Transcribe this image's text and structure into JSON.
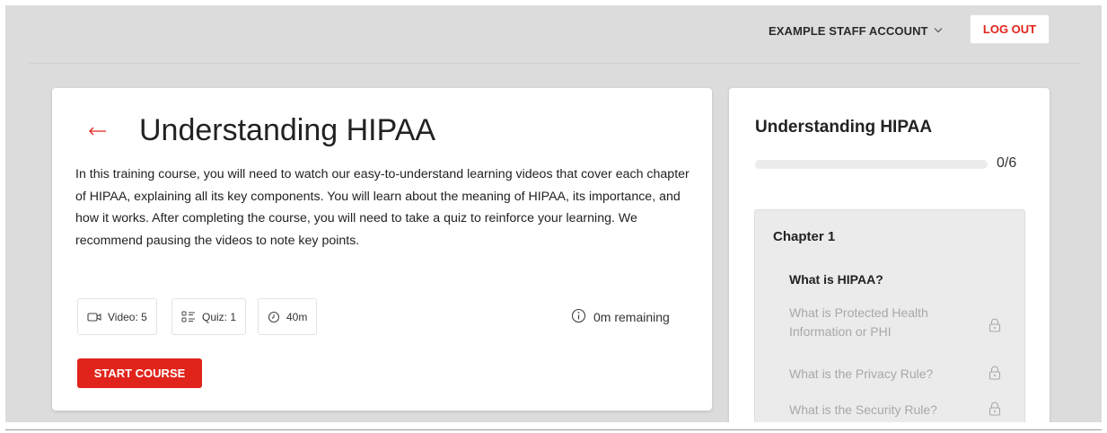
{
  "header": {
    "account_label": "EXAMPLE STAFF ACCOUNT",
    "logout_label": "LOG OUT"
  },
  "course": {
    "title": "Understanding HIPAA",
    "description": "In this training course, you will need to watch our easy-to-understand learning videos that cover each chapter of HIPAA, explaining all its key components. You will learn about the meaning of HIPAA, its importance, and how it works. After completing the course, you will need to take a quiz to reinforce your learning. We recommend pausing the videos to note key points.",
    "stats": {
      "video": "Video: 5",
      "quiz": "Quiz: 1",
      "duration": "40m"
    },
    "remaining": "0m remaining",
    "start_label": "START COURSE"
  },
  "sidebar": {
    "title": "Understanding HIPAA",
    "progress_count": "0/6",
    "progress_fraction": 0,
    "chapter_title": "Chapter 1",
    "lessons": [
      {
        "label": "What is HIPAA?",
        "locked": false
      },
      {
        "label": "What is Protected Health Information or PHI",
        "locked": true
      },
      {
        "label": "What is the Privacy Rule?",
        "locked": true
      },
      {
        "label": "What is the Security Rule?",
        "locked": true
      }
    ]
  },
  "colors": {
    "accent": "#e0241b",
    "background": "#dcdcdc",
    "card": "#ffffff",
    "locked_text": "#a8a8a8"
  },
  "icons": [
    "chevron-down-icon",
    "arrow-left-icon",
    "video-icon",
    "quiz-icon",
    "clock-icon",
    "info-icon",
    "lock-icon"
  ]
}
